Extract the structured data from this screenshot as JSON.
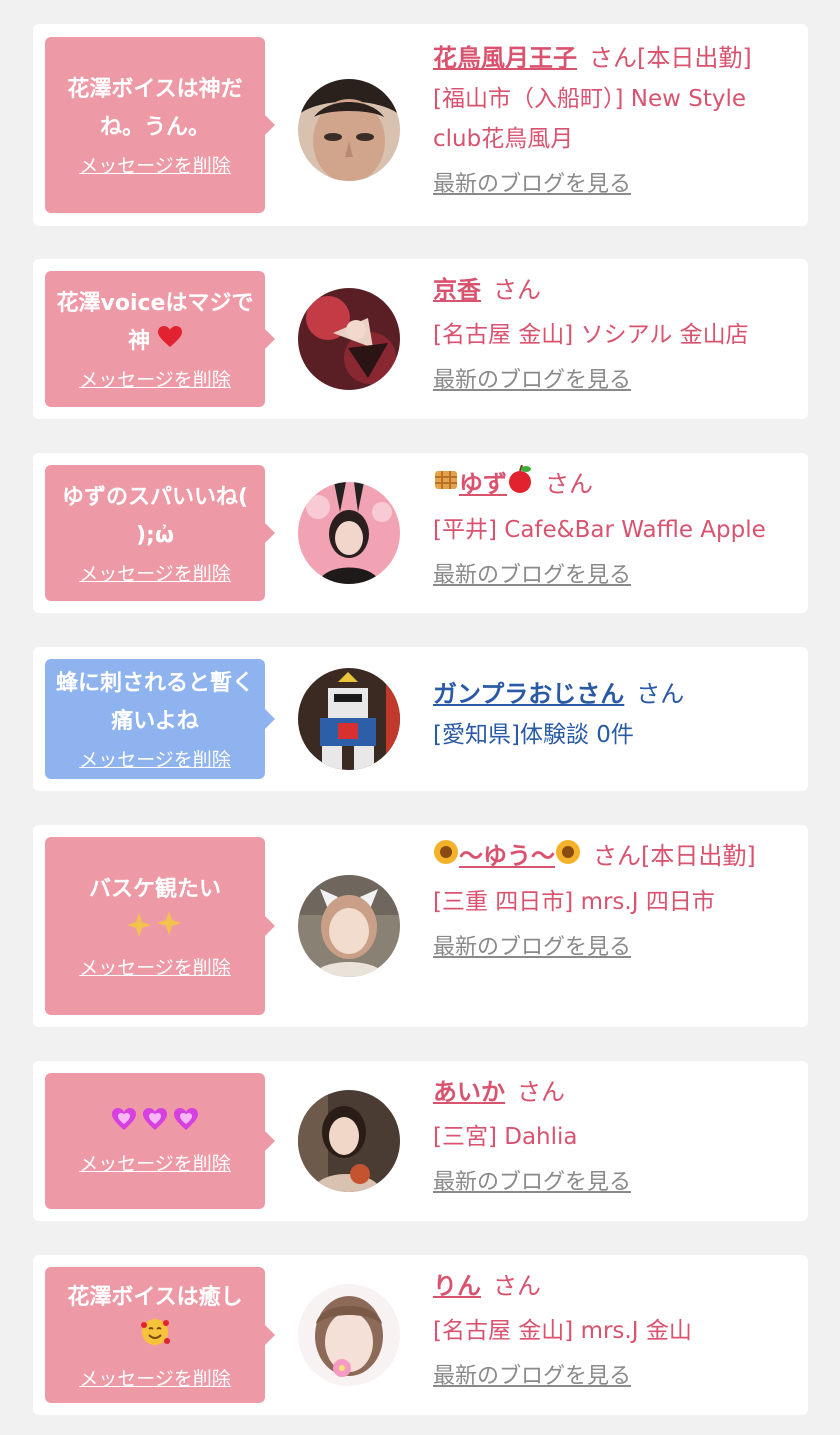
{
  "cards": [
    {
      "bubble_color": "pink",
      "message": "花澤ボイスは神だね。うん。",
      "delete_label": "メッセージを削除",
      "name": "花鳥風月王子",
      "suffix": "さん[本日出勤]",
      "shop": "[福山市（入船町）] New Style club花鳥風月",
      "blog": "最新のブログを見る"
    },
    {
      "bubble_color": "pink",
      "message": "花澤voiceはマジで神",
      "delete_label": "メッセージを削除",
      "name": "京香",
      "suffix": "さん",
      "shop": "[名古屋 金山] ソシアル 金山店",
      "blog": "最新のブログを見る"
    },
    {
      "bubble_color": "pink",
      "message": "ゆずのスパいいね( );ὠ",
      "delete_label": "メッセージを削除",
      "name": "ゆず",
      "suffix": "さん",
      "shop": "[平井] Cafe&Bar Waffle Apple",
      "blog": "最新のブログを見る"
    },
    {
      "bubble_color": "blue",
      "message": "蜂に刺されると暫く痛いよね",
      "delete_label": "メッセージを削除",
      "name": "ガンプラおじさん",
      "suffix": "さん",
      "shop": "[愛知県]体験談 0件",
      "blog": ""
    },
    {
      "bubble_color": "pink",
      "message": "バスケ観たい",
      "delete_label": "メッセージを削除",
      "name": "〜ゆう〜",
      "suffix": "さん[本日出勤]",
      "shop": "[三重 四日市] mrs.J 四日市",
      "blog": "最新のブログを見る"
    },
    {
      "bubble_color": "pink",
      "message": "",
      "delete_label": "メッセージを削除",
      "name": "あいか",
      "suffix": "さん",
      "shop": "[三宮] Dahlia",
      "blog": "最新のブログを見る"
    },
    {
      "bubble_color": "pink",
      "message": "花澤ボイスは癒し",
      "delete_label": "メッセージを削除",
      "name": "りん",
      "suffix": "さん",
      "shop": "[名古屋 金山] mrs.J 金山",
      "blog": "最新のブログを見る"
    }
  ],
  "icons": [
    "heart-icon",
    "waffle-icon",
    "apple-icon",
    "sunflower-icon",
    "sparkles-icon",
    "smiling-hearts-face-icon"
  ],
  "colors": {
    "background": "#f1f1f1",
    "card": "#ffffff",
    "pink_bubble": "#ee9aa6",
    "blue_bubble": "#8fb3ef",
    "pink_text": "#d9536f",
    "blue_text": "#2a5aa6",
    "blog_link": "#8a8a8a"
  }
}
